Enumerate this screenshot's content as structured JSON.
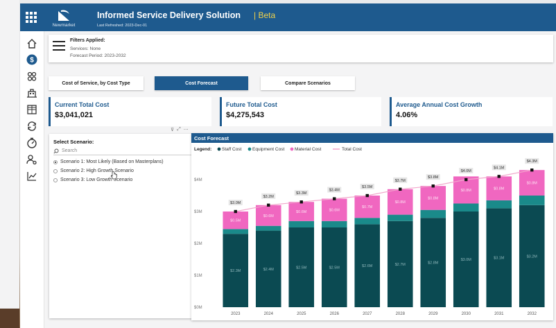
{
  "app": {
    "title": "Informed Service Delivery Solution",
    "beta": "| Beta",
    "refreshed": "Last Refreshed: 2023-Dec-01",
    "logo_text": "Newmarket"
  },
  "nav": [
    "home-icon",
    "dollar-icon",
    "people-icon",
    "building-icon",
    "grid-icon",
    "cycle-icon",
    "gauge-icon",
    "user-settings-icon",
    "trend-chart-icon"
  ],
  "filters": {
    "title": "Filters Applied:",
    "services": "Services: None",
    "period": "Forecast Period: 2023-2032"
  },
  "tabs": [
    {
      "label": "Cost of Service, by Cost Type",
      "active": false
    },
    {
      "label": "Cost Forecast",
      "active": true
    },
    {
      "label": "Compare Scenarios",
      "active": false
    }
  ],
  "kpis": [
    {
      "label": "Current Total Cost",
      "value": "$3,041,021"
    },
    {
      "label": "Future Total Cost",
      "value": "$4,275,543"
    },
    {
      "label": "Average Annual Cost Growth",
      "value": "4.06%"
    }
  ],
  "scenario": {
    "title": "Select Scenario:",
    "search_placeholder": "Search",
    "options": [
      {
        "label": "Scenario 1: Most Likely (Based on Masterplans)",
        "selected": true
      },
      {
        "label": "Scenario 2: High Growth Scenario",
        "selected": false
      },
      {
        "label": "Scenario 3: Low Growth Scenario",
        "selected": false
      }
    ]
  },
  "colors": {
    "accent": "#1e5a8e",
    "staff": "#0b4a52",
    "equipment": "#1a8a8a",
    "material": "#f067c0",
    "total_line": "#f2a6cc"
  },
  "chart_data": {
    "type": "bar",
    "title": "Cost Forecast",
    "legend_label": "Legend:",
    "legend_position": "top-left",
    "categories": [
      "2023",
      "2024",
      "2025",
      "2026",
      "2027",
      "2028",
      "2029",
      "2030",
      "2031",
      "2032"
    ],
    "series": [
      {
        "name": "Staff Cost",
        "values": [
          2.3,
          2.4,
          2.5,
          2.5,
          2.6,
          2.7,
          2.8,
          3.0,
          3.1,
          3.2
        ],
        "labels": [
          "$2.3M",
          "$2.4M",
          "$2.5M",
          "$2.5M",
          "$2.6M",
          "$2.7M",
          "$2.8M",
          "$3.0M",
          "$3.1M",
          "$3.2M"
        ]
      },
      {
        "name": "Equipment Cost",
        "values": [
          0.15,
          0.15,
          0.2,
          0.2,
          0.2,
          0.2,
          0.25,
          0.25,
          0.25,
          0.3
        ],
        "labels": []
      },
      {
        "name": "Material Cost",
        "values": [
          0.55,
          0.65,
          0.6,
          0.7,
          0.7,
          0.8,
          0.75,
          0.85,
          0.75,
          0.8
        ],
        "labels": [
          "$0.5M",
          "$0.6M",
          "$0.6M",
          "$0.6M",
          "$0.7M",
          "$0.8M",
          "$0.8M",
          "$0.8M",
          "$0.8M",
          "$0.8M"
        ]
      },
      {
        "name": "Total Cost",
        "type": "line",
        "values": [
          3.0,
          3.2,
          3.3,
          3.4,
          3.5,
          3.7,
          3.8,
          4.0,
          4.1,
          4.3
        ],
        "labels": [
          "$3.0M",
          "$3.2M",
          "$3.3M",
          "$3.4M",
          "$3.5M",
          "$3.7M",
          "$3.8M",
          "$4.0M",
          "$4.1M",
          "$4.3M"
        ]
      }
    ],
    "ylim": [
      0,
      4.5
    ],
    "yticks": [
      0,
      1,
      2,
      3,
      4
    ],
    "ytick_labels": [
      "$0M",
      "$1M",
      "$2M",
      "$3M",
      "$4M"
    ],
    "grid": false
  }
}
